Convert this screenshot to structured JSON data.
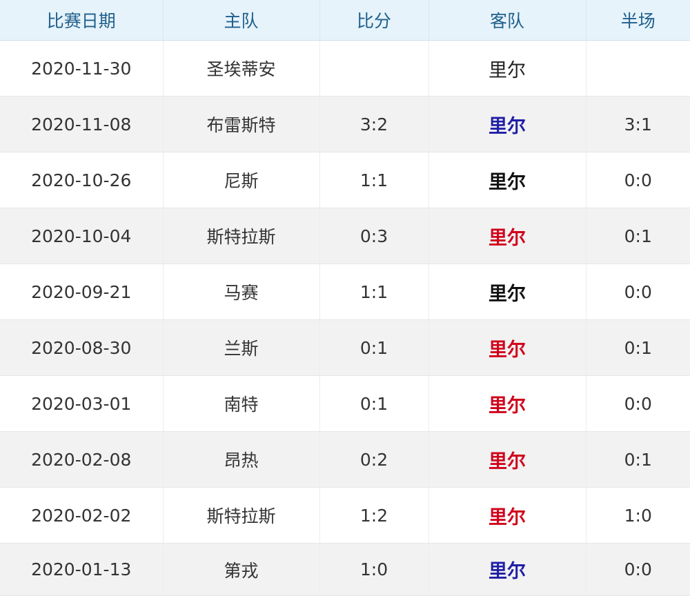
{
  "headers": {
    "date": "比赛日期",
    "home": "主队",
    "score": "比分",
    "away": "客队",
    "half": "半场"
  },
  "colors": {
    "header_bg": "#e6f3fb",
    "header_text": "#1f5f8b",
    "win": "#d0021b",
    "loss": "#1f1fa6",
    "draw": "#111111"
  },
  "rows": [
    {
      "date": "2020-11-30",
      "home": "圣埃蒂安",
      "score": "",
      "away": "里尔",
      "half": "",
      "result": "pending"
    },
    {
      "date": "2020-11-08",
      "home": "布雷斯特",
      "score": "3:2",
      "away": "里尔",
      "half": "3:1",
      "result": "loss"
    },
    {
      "date": "2020-10-26",
      "home": "尼斯",
      "score": "1:1",
      "away": "里尔",
      "half": "0:0",
      "result": "draw"
    },
    {
      "date": "2020-10-04",
      "home": "斯特拉斯",
      "score": "0:3",
      "away": "里尔",
      "half": "0:1",
      "result": "win"
    },
    {
      "date": "2020-09-21",
      "home": "马赛",
      "score": "1:1",
      "away": "里尔",
      "half": "0:0",
      "result": "draw"
    },
    {
      "date": "2020-08-30",
      "home": "兰斯",
      "score": "0:1",
      "away": "里尔",
      "half": "0:1",
      "result": "win"
    },
    {
      "date": "2020-03-01",
      "home": "南特",
      "score": "0:1",
      "away": "里尔",
      "half": "0:0",
      "result": "win"
    },
    {
      "date": "2020-02-08",
      "home": "昂热",
      "score": "0:2",
      "away": "里尔",
      "half": "0:1",
      "result": "win"
    },
    {
      "date": "2020-02-02",
      "home": "斯特拉斯",
      "score": "1:2",
      "away": "里尔",
      "half": "1:0",
      "result": "win"
    },
    {
      "date": "2020-01-13",
      "home": "第戎",
      "score": "1:0",
      "away": "里尔",
      "half": "0:0",
      "result": "loss"
    }
  ]
}
